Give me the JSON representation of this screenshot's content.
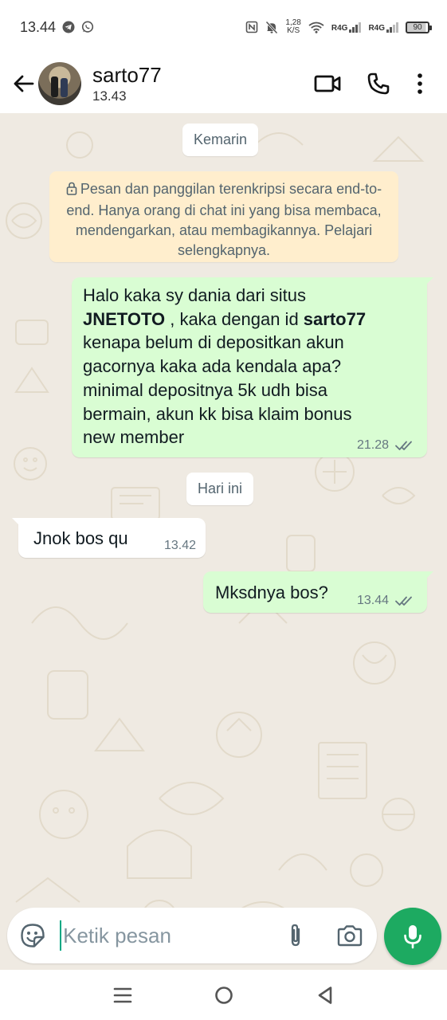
{
  "status_bar": {
    "time": "13.44",
    "speed_value": "1,28",
    "speed_unit": "K/S",
    "network1": "R4G",
    "network2": "R4G",
    "battery": "90",
    "icons": [
      "telegram-icon",
      "whatsapp-icon",
      "nfc-icon",
      "mute-icon",
      "wifi-icon",
      "signal-icon",
      "battery-icon"
    ]
  },
  "header": {
    "contact_name": "sarto77",
    "last_seen": "13.43",
    "icons": [
      "back-arrow-icon",
      "video-call-icon",
      "voice-call-icon",
      "more-options-icon"
    ]
  },
  "chat": {
    "date_yesterday": "Kemarin",
    "encryption_notice": "Pesan dan panggilan terenkripsi secara end-to-end. Hanya orang di chat ini yang bisa membaca, mendengarkan, atau membagikannya. Pelajari selengkapnya.",
    "date_today": "Hari ini",
    "messages": [
      {
        "direction": "outgoing",
        "line1": "Halo kaka sy dania dari situs",
        "bold1": "JNETOTO",
        "mid": " , kaka dengan id  ",
        "bold2": "sarto77",
        "rest": "kenapa belum di depositkan akun\ngacornya kaka ada kendala apa?\nminimal depositnya 5k udh bisa\nbermain, akun kk bisa klaim bonus\nnew member",
        "time": "21.28",
        "status": "read"
      },
      {
        "direction": "incoming",
        "text": "Jnok bos qu",
        "time": "13.42"
      },
      {
        "direction": "outgoing",
        "text": "Mksdnya bos?",
        "time": "13.44",
        "status": "read"
      }
    ]
  },
  "composer": {
    "placeholder": "Ketik pesan",
    "value": "",
    "icons": [
      "emoji-sticker-icon",
      "attach-icon",
      "camera-icon",
      "microphone-icon"
    ]
  },
  "colors": {
    "outgoing_bubble": "#d9fdd3",
    "incoming_bubble": "#ffffff",
    "chat_background": "#efeae2",
    "encryption_banner": "#ffeecd",
    "read_ticks": "#667781",
    "mic_button": "#1daa61"
  },
  "navigation": {
    "icons": [
      "recent-apps-icon",
      "home-icon",
      "back-icon"
    ]
  }
}
